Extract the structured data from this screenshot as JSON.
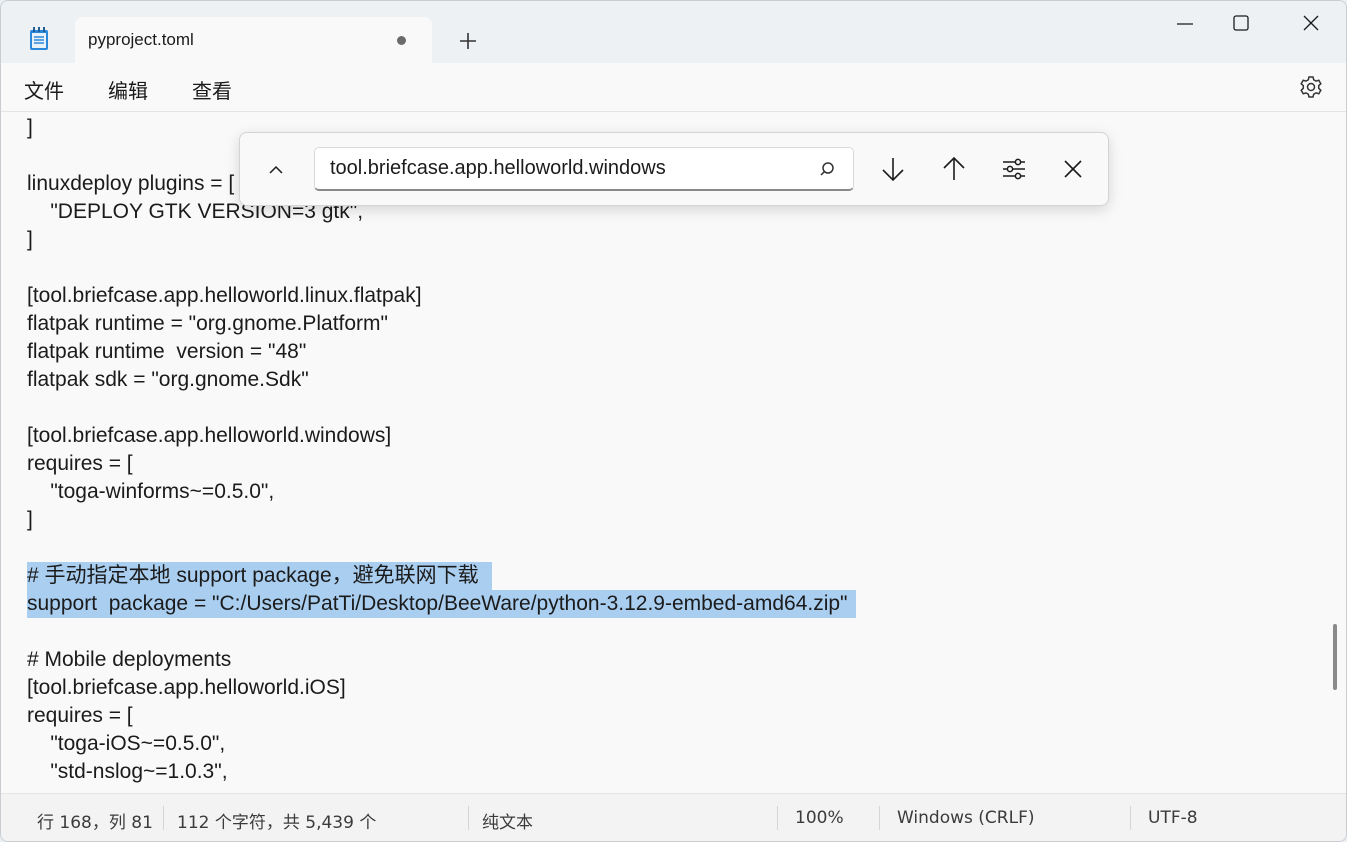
{
  "tab": {
    "title": "pyproject.toml"
  },
  "menu": {
    "file": "文件",
    "edit": "编辑",
    "view": "查看"
  },
  "find": {
    "query": "tool.briefcase.app.helloworld.windows"
  },
  "editor": {
    "lines": [
      "]",
      "",
      "linuxdeploy plugins = [",
      "    \"DEPLOY GTK VERSION=3 gtk\",",
      "]",
      "",
      "[tool.briefcase.app.helloworld.linux.flatpak]",
      "flatpak runtime = \"org.gnome.Platform\"",
      "flatpak runtime  version = \"48\"",
      "flatpak sdk = \"org.gnome.Sdk\"",
      "",
      "[tool.briefcase.app.helloworld.windows]",
      "requires = [",
      "    \"toga-winforms~=0.5.0\",",
      "]",
      "",
      "# 手动指定本地 support package，避免联网下载 ",
      "support  package = \"C:/Users/PatTi/Desktop/BeeWare/python-3.12.9-embed-amd64.zip\"",
      "",
      "# Mobile deployments",
      "[tool.briefcase.app.helloworld.iOS]",
      "requires = [",
      "    \"toga-iOS~=0.5.0\",",
      "    \"std-nslog~=1.0.3\","
    ]
  },
  "status": {
    "position": "行 168，列 81",
    "selection": "112 个字符，共 5,439 个",
    "format": "纯文本",
    "zoom": "100%",
    "line_ending": "Windows (CRLF)",
    "encoding": "UTF-8"
  },
  "colors": {
    "selection": "#a9cef0",
    "accent": "#0067c0"
  }
}
